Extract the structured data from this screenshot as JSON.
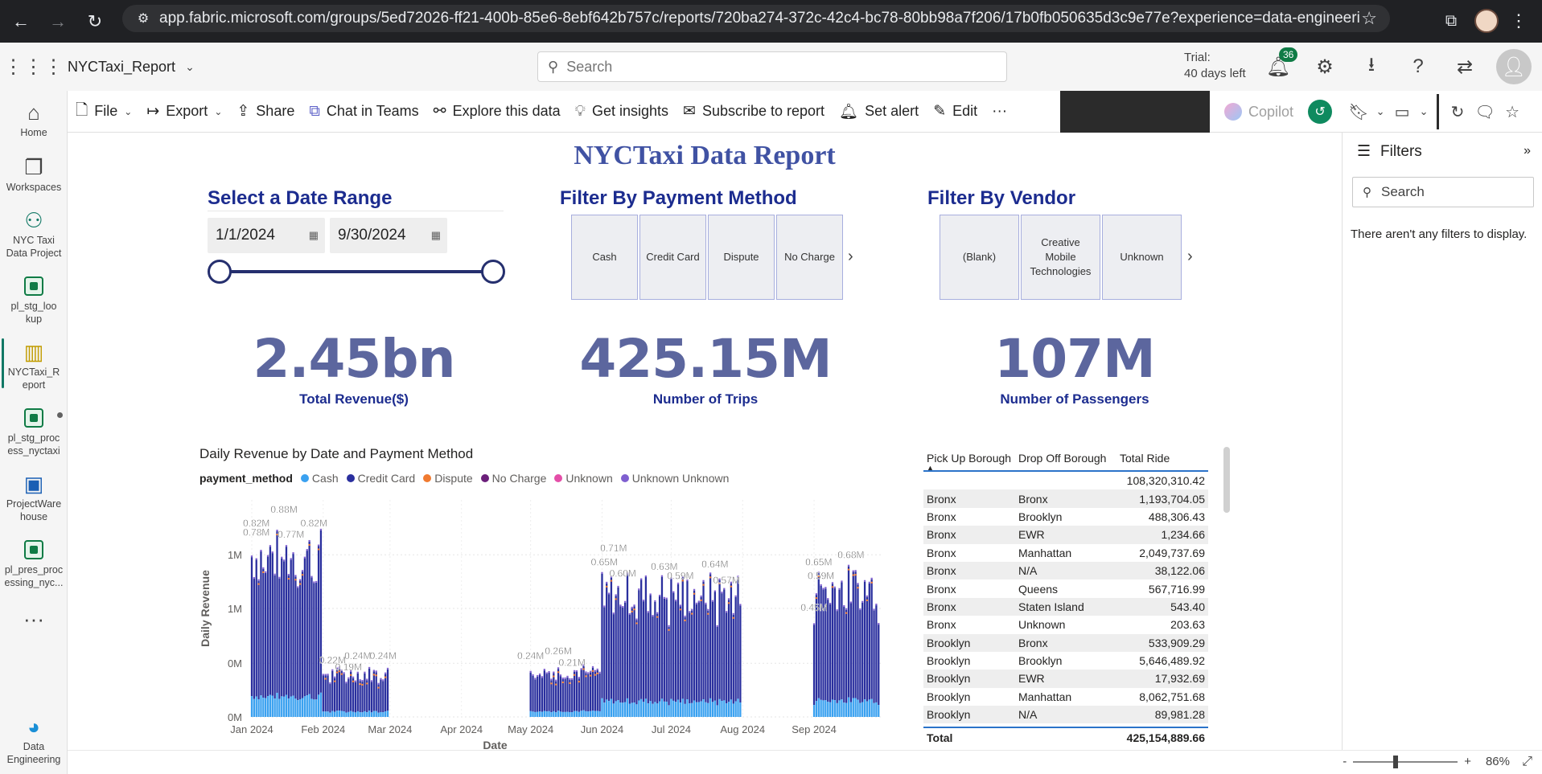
{
  "browser": {
    "url": "app.fabric.microsoft.com/groups/5ed72026-ff21-400b-85e6-8ebf642b757c/reports/720ba274-372c-42c4-bc78-80bb98a7f206/17b0fb050635d3c9e77e?experience=data-engineering"
  },
  "header": {
    "report_name": "NYCTaxi_Report",
    "search_placeholder": "Search",
    "trial_line1": "Trial:",
    "trial_line2": "40 days left",
    "notification_count": "36"
  },
  "rail": {
    "items": [
      {
        "label": "Home",
        "icon": "home-icon"
      },
      {
        "label": "Workspaces",
        "icon": "workspaces-icon"
      },
      {
        "label": "NYC Taxi Data Project",
        "icon": "project-icon"
      },
      {
        "label": "pl_stg_lookup",
        "icon": "pipeline-icon"
      },
      {
        "label": "NYCTaxi_Report",
        "icon": "report-icon"
      },
      {
        "label": "pl_stg_process_nyctaxi",
        "icon": "pipeline-icon"
      },
      {
        "label": "ProjectWarehouse",
        "icon": "warehouse-icon"
      },
      {
        "label": "pl_pres_processing_nyc...",
        "icon": "pipeline-icon"
      },
      {
        "label": "Data Engineering",
        "icon": "data-engineering-icon"
      }
    ]
  },
  "toolbar": {
    "file": "File",
    "export": "Export",
    "share": "Share",
    "chat_teams": "Chat in Teams",
    "explore": "Explore this data",
    "insights": "Get insights",
    "subscribe": "Subscribe to report",
    "set_alert": "Set alert",
    "edit": "Edit",
    "copilot": "Copilot"
  },
  "report": {
    "title": "NYCTaxi Data Report",
    "date_slicer": {
      "title": "Select a Date Range",
      "start": "1/1/2024",
      "end": "9/30/2024"
    },
    "payment_slicer": {
      "title": "Filter By Payment Method",
      "options": [
        "Cash",
        "Credit Card",
        "Dispute",
        "No Charge"
      ]
    },
    "vendor_slicer": {
      "title": "Filter By Vendor",
      "options": [
        "(Blank)",
        "Creative Mobile Technologies",
        "Unknown"
      ]
    },
    "kpis": [
      {
        "value": "2.45bn",
        "label": "Total Revenue($)"
      },
      {
        "value": "425.15M",
        "label": "Number of Trips"
      },
      {
        "value": "107M",
        "label": "Number of Passengers"
      }
    ]
  },
  "chart_data": {
    "type": "bar",
    "title": "Daily Revenue by Date and Payment Method",
    "legend_title": "payment_method",
    "series_names": [
      "Cash",
      "Credit Card",
      "Dispute",
      "No Charge",
      "Unknown",
      "Unknown Unknown"
    ],
    "colors": {
      "Cash": "#3aa1f0",
      "Credit Card": "#2a2f9e",
      "Dispute": "#f07a30",
      "No Charge": "#6b1f7a",
      "Unknown": "#e44ea8",
      "Unknown Unknown": "#7f5fd0"
    },
    "xlabel": "Date",
    "ylabel": "Daily Revenue",
    "x_ticks": [
      "Jan 2024",
      "Feb 2024",
      "Mar 2024",
      "Apr 2024",
      "May 2024",
      "Jun 2024",
      "Jul 2024",
      "Aug 2024",
      "Sep 2024"
    ],
    "y_ticks": [
      "0M",
      "0M",
      "1M",
      "1M"
    ],
    "segments": [
      {
        "start": "2024-01-01",
        "end": "2024-02-01",
        "base_level": 0.72
      },
      {
        "start": "2024-02-01",
        "end": "2024-03-01",
        "base_level": 0.19
      },
      {
        "start": "2024-05-01",
        "end": "2024-06-01",
        "base_level": 0.2
      },
      {
        "start": "2024-06-01",
        "end": "2024-08-01",
        "base_level": 0.55
      },
      {
        "start": "2024-09-01",
        "end": "2024-09-30",
        "base_level": 0.58
      }
    ],
    "data_labels": [
      {
        "date": "2024-01-03",
        "value": 0.82,
        "text": "0.82M"
      },
      {
        "date": "2024-01-15",
        "value": 0.88,
        "text": "0.88M"
      },
      {
        "date": "2024-01-03",
        "value": 0.78,
        "text": "0.78M"
      },
      {
        "date": "2024-01-28",
        "value": 0.82,
        "text": "0.82M"
      },
      {
        "date": "2024-01-18",
        "value": 0.77,
        "text": "0.77M"
      },
      {
        "date": "2024-02-05",
        "value": 0.22,
        "text": "0.22M"
      },
      {
        "date": "2024-02-16",
        "value": 0.24,
        "text": "0.24M"
      },
      {
        "date": "2024-02-12",
        "value": 0.19,
        "text": "0.19M"
      },
      {
        "date": "2024-02-27",
        "value": 0.24,
        "text": "0.24M"
      },
      {
        "date": "2024-05-01",
        "value": 0.24,
        "text": "0.24M"
      },
      {
        "date": "2024-05-13",
        "value": 0.26,
        "text": "0.26M"
      },
      {
        "date": "2024-05-19",
        "value": 0.21,
        "text": "0.21M"
      },
      {
        "date": "2024-06-02",
        "value": 0.65,
        "text": "0.65M"
      },
      {
        "date": "2024-06-06",
        "value": 0.71,
        "text": "0.71M"
      },
      {
        "date": "2024-06-10",
        "value": 0.6,
        "text": "0.60M"
      },
      {
        "date": "2024-06-28",
        "value": 0.63,
        "text": "0.63M"
      },
      {
        "date": "2024-07-05",
        "value": 0.59,
        "text": "0.59M"
      },
      {
        "date": "2024-07-20",
        "value": 0.64,
        "text": "0.64M"
      },
      {
        "date": "2024-07-25",
        "value": 0.57,
        "text": "0.57M"
      },
      {
        "date": "2024-09-03",
        "value": 0.65,
        "text": "0.65M"
      },
      {
        "date": "2024-09-04",
        "value": 0.59,
        "text": "0.59M"
      },
      {
        "date": "2024-09-17",
        "value": 0.68,
        "text": "0.68M"
      },
      {
        "date": "2024-09-01",
        "value": 0.45,
        "text": "0.45M"
      }
    ]
  },
  "matrix": {
    "headers": [
      "Pick Up Borough",
      "Drop Off Borough",
      "Total Ride"
    ],
    "subtotal": "108,320,310.42",
    "rows": [
      [
        "Bronx",
        "Bronx",
        "1,193,704.05"
      ],
      [
        "Bronx",
        "Brooklyn",
        "488,306.43"
      ],
      [
        "Bronx",
        "EWR",
        "1,234.66"
      ],
      [
        "Bronx",
        "Manhattan",
        "2,049,737.69"
      ],
      [
        "Bronx",
        "N/A",
        "38,122.06"
      ],
      [
        "Bronx",
        "Queens",
        "567,716.99"
      ],
      [
        "Bronx",
        "Staten Island",
        "543.40"
      ],
      [
        "Bronx",
        "Unknown",
        "203.63"
      ],
      [
        "Brooklyn",
        "Bronx",
        "533,909.29"
      ],
      [
        "Brooklyn",
        "Brooklyn",
        "5,646,489.92"
      ],
      [
        "Brooklyn",
        "EWR",
        "17,932.69"
      ],
      [
        "Brooklyn",
        "Manhattan",
        "8,062,751.68"
      ],
      [
        "Brooklyn",
        "N/A",
        "89,981.28"
      ]
    ],
    "total_label": "Total",
    "total_value": "425,154,889.66"
  },
  "filters": {
    "title": "Filters",
    "search_placeholder": "Search",
    "empty_message": "There aren't any filters to display."
  },
  "status": {
    "zoom": "86%"
  }
}
